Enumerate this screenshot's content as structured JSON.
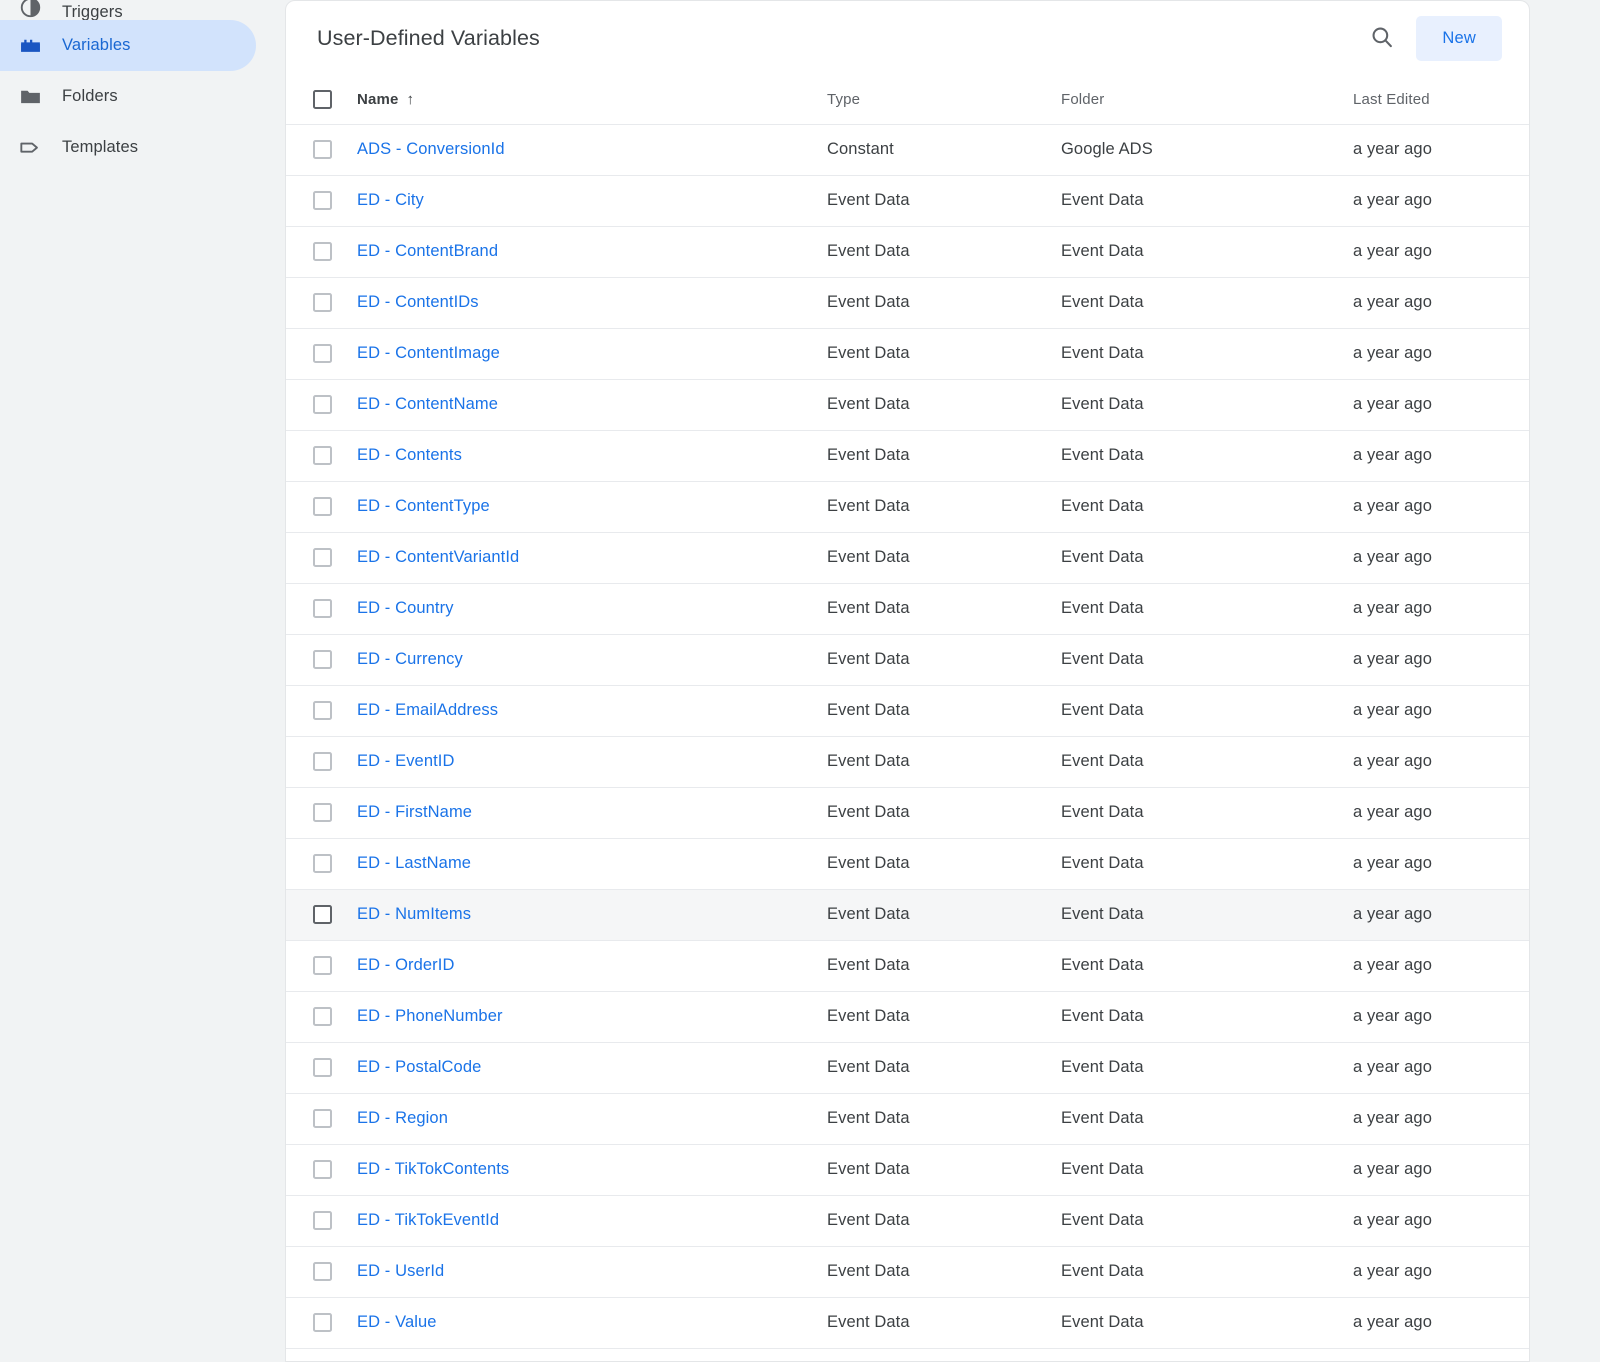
{
  "sidebar": {
    "items": [
      {
        "label": "Triggers",
        "icon": "triggers-icon",
        "active": false,
        "partial": true
      },
      {
        "label": "Variables",
        "icon": "variables-icon",
        "active": true,
        "partial": false
      },
      {
        "label": "Folders",
        "icon": "folder-icon",
        "active": false,
        "partial": false
      },
      {
        "label": "Templates",
        "icon": "tag-icon",
        "active": false,
        "partial": false
      }
    ]
  },
  "panel": {
    "title": "User-Defined Variables",
    "search_icon": "search-icon",
    "new_button": "New"
  },
  "table": {
    "columns": {
      "name": "Name",
      "sort_arrow": "↑",
      "type": "Type",
      "folder": "Folder",
      "last_edited": "Last Edited"
    },
    "hovered_row_index": 15,
    "rows": [
      {
        "name": "ADS - ConversionId",
        "type": "Constant",
        "folder": "Google ADS",
        "last_edited": "a year ago"
      },
      {
        "name": "ED - City",
        "type": "Event Data",
        "folder": "Event Data",
        "last_edited": "a year ago"
      },
      {
        "name": "ED - ContentBrand",
        "type": "Event Data",
        "folder": "Event Data",
        "last_edited": "a year ago"
      },
      {
        "name": "ED - ContentIDs",
        "type": "Event Data",
        "folder": "Event Data",
        "last_edited": "a year ago"
      },
      {
        "name": "ED - ContentImage",
        "type": "Event Data",
        "folder": "Event Data",
        "last_edited": "a year ago"
      },
      {
        "name": "ED - ContentName",
        "type": "Event Data",
        "folder": "Event Data",
        "last_edited": "a year ago"
      },
      {
        "name": "ED - Contents",
        "type": "Event Data",
        "folder": "Event Data",
        "last_edited": "a year ago"
      },
      {
        "name": "ED - ContentType",
        "type": "Event Data",
        "folder": "Event Data",
        "last_edited": "a year ago"
      },
      {
        "name": "ED - ContentVariantId",
        "type": "Event Data",
        "folder": "Event Data",
        "last_edited": "a year ago"
      },
      {
        "name": "ED - Country",
        "type": "Event Data",
        "folder": "Event Data",
        "last_edited": "a year ago"
      },
      {
        "name": "ED - Currency",
        "type": "Event Data",
        "folder": "Event Data",
        "last_edited": "a year ago"
      },
      {
        "name": "ED - EmailAddress",
        "type": "Event Data",
        "folder": "Event Data",
        "last_edited": "a year ago"
      },
      {
        "name": "ED - EventID",
        "type": "Event Data",
        "folder": "Event Data",
        "last_edited": "a year ago"
      },
      {
        "name": "ED - FirstName",
        "type": "Event Data",
        "folder": "Event Data",
        "last_edited": "a year ago"
      },
      {
        "name": "ED - LastName",
        "type": "Event Data",
        "folder": "Event Data",
        "last_edited": "a year ago"
      },
      {
        "name": "ED - NumItems",
        "type": "Event Data",
        "folder": "Event Data",
        "last_edited": "a year ago"
      },
      {
        "name": "ED - OrderID",
        "type": "Event Data",
        "folder": "Event Data",
        "last_edited": "a year ago"
      },
      {
        "name": "ED - PhoneNumber",
        "type": "Event Data",
        "folder": "Event Data",
        "last_edited": "a year ago"
      },
      {
        "name": "ED - PostalCode",
        "type": "Event Data",
        "folder": "Event Data",
        "last_edited": "a year ago"
      },
      {
        "name": "ED - Region",
        "type": "Event Data",
        "folder": "Event Data",
        "last_edited": "a year ago"
      },
      {
        "name": "ED - TikTokContents",
        "type": "Event Data",
        "folder": "Event Data",
        "last_edited": "a year ago"
      },
      {
        "name": "ED - TikTokEventId",
        "type": "Event Data",
        "folder": "Event Data",
        "last_edited": "a year ago"
      },
      {
        "name": "ED - UserId",
        "type": "Event Data",
        "folder": "Event Data",
        "last_edited": "a year ago"
      },
      {
        "name": "ED - Value",
        "type": "Event Data",
        "folder": "Event Data",
        "last_edited": "a year ago"
      }
    ]
  },
  "colors": {
    "accent": "#1a73e8",
    "active_nav_bg": "#d2e3fc",
    "active_nav_text": "#1967d2",
    "page_bg": "#f1f3f4",
    "panel_bg": "#ffffff",
    "row_hover_bg": "#f5f6f7",
    "text": "#3c4043",
    "muted_text": "#5f6368"
  }
}
